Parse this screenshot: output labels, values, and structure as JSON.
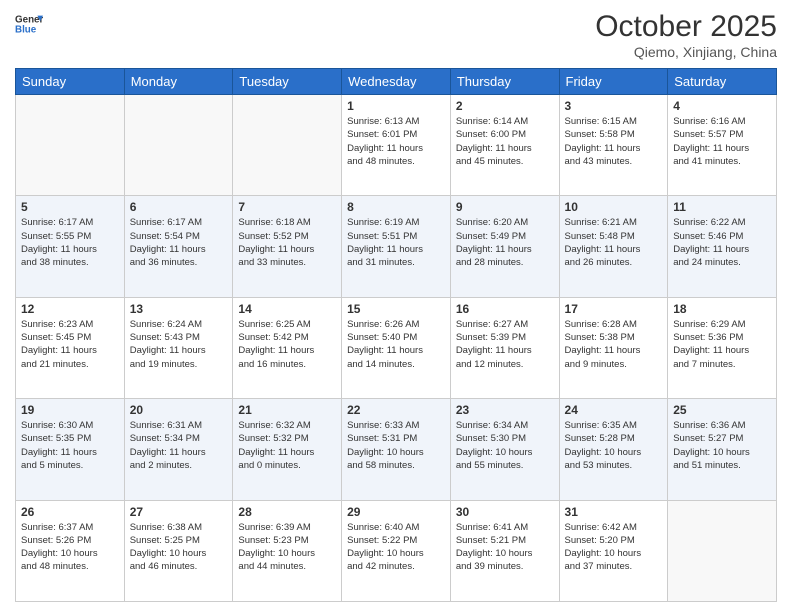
{
  "header": {
    "title": "October 2025",
    "location": "Qiemo, Xinjiang, China"
  },
  "weekdays": [
    "Sunday",
    "Monday",
    "Tuesday",
    "Wednesday",
    "Thursday",
    "Friday",
    "Saturday"
  ],
  "weeks": [
    [
      {
        "day": "",
        "info": ""
      },
      {
        "day": "",
        "info": ""
      },
      {
        "day": "",
        "info": ""
      },
      {
        "day": "1",
        "info": "Sunrise: 6:13 AM\nSunset: 6:01 PM\nDaylight: 11 hours\nand 48 minutes."
      },
      {
        "day": "2",
        "info": "Sunrise: 6:14 AM\nSunset: 6:00 PM\nDaylight: 11 hours\nand 45 minutes."
      },
      {
        "day": "3",
        "info": "Sunrise: 6:15 AM\nSunset: 5:58 PM\nDaylight: 11 hours\nand 43 minutes."
      },
      {
        "day": "4",
        "info": "Sunrise: 6:16 AM\nSunset: 5:57 PM\nDaylight: 11 hours\nand 41 minutes."
      }
    ],
    [
      {
        "day": "5",
        "info": "Sunrise: 6:17 AM\nSunset: 5:55 PM\nDaylight: 11 hours\nand 38 minutes."
      },
      {
        "day": "6",
        "info": "Sunrise: 6:17 AM\nSunset: 5:54 PM\nDaylight: 11 hours\nand 36 minutes."
      },
      {
        "day": "7",
        "info": "Sunrise: 6:18 AM\nSunset: 5:52 PM\nDaylight: 11 hours\nand 33 minutes."
      },
      {
        "day": "8",
        "info": "Sunrise: 6:19 AM\nSunset: 5:51 PM\nDaylight: 11 hours\nand 31 minutes."
      },
      {
        "day": "9",
        "info": "Sunrise: 6:20 AM\nSunset: 5:49 PM\nDaylight: 11 hours\nand 28 minutes."
      },
      {
        "day": "10",
        "info": "Sunrise: 6:21 AM\nSunset: 5:48 PM\nDaylight: 11 hours\nand 26 minutes."
      },
      {
        "day": "11",
        "info": "Sunrise: 6:22 AM\nSunset: 5:46 PM\nDaylight: 11 hours\nand 24 minutes."
      }
    ],
    [
      {
        "day": "12",
        "info": "Sunrise: 6:23 AM\nSunset: 5:45 PM\nDaylight: 11 hours\nand 21 minutes."
      },
      {
        "day": "13",
        "info": "Sunrise: 6:24 AM\nSunset: 5:43 PM\nDaylight: 11 hours\nand 19 minutes."
      },
      {
        "day": "14",
        "info": "Sunrise: 6:25 AM\nSunset: 5:42 PM\nDaylight: 11 hours\nand 16 minutes."
      },
      {
        "day": "15",
        "info": "Sunrise: 6:26 AM\nSunset: 5:40 PM\nDaylight: 11 hours\nand 14 minutes."
      },
      {
        "day": "16",
        "info": "Sunrise: 6:27 AM\nSunset: 5:39 PM\nDaylight: 11 hours\nand 12 minutes."
      },
      {
        "day": "17",
        "info": "Sunrise: 6:28 AM\nSunset: 5:38 PM\nDaylight: 11 hours\nand 9 minutes."
      },
      {
        "day": "18",
        "info": "Sunrise: 6:29 AM\nSunset: 5:36 PM\nDaylight: 11 hours\nand 7 minutes."
      }
    ],
    [
      {
        "day": "19",
        "info": "Sunrise: 6:30 AM\nSunset: 5:35 PM\nDaylight: 11 hours\nand 5 minutes."
      },
      {
        "day": "20",
        "info": "Sunrise: 6:31 AM\nSunset: 5:34 PM\nDaylight: 11 hours\nand 2 minutes."
      },
      {
        "day": "21",
        "info": "Sunrise: 6:32 AM\nSunset: 5:32 PM\nDaylight: 11 hours\nand 0 minutes."
      },
      {
        "day": "22",
        "info": "Sunrise: 6:33 AM\nSunset: 5:31 PM\nDaylight: 10 hours\nand 58 minutes."
      },
      {
        "day": "23",
        "info": "Sunrise: 6:34 AM\nSunset: 5:30 PM\nDaylight: 10 hours\nand 55 minutes."
      },
      {
        "day": "24",
        "info": "Sunrise: 6:35 AM\nSunset: 5:28 PM\nDaylight: 10 hours\nand 53 minutes."
      },
      {
        "day": "25",
        "info": "Sunrise: 6:36 AM\nSunset: 5:27 PM\nDaylight: 10 hours\nand 51 minutes."
      }
    ],
    [
      {
        "day": "26",
        "info": "Sunrise: 6:37 AM\nSunset: 5:26 PM\nDaylight: 10 hours\nand 48 minutes."
      },
      {
        "day": "27",
        "info": "Sunrise: 6:38 AM\nSunset: 5:25 PM\nDaylight: 10 hours\nand 46 minutes."
      },
      {
        "day": "28",
        "info": "Sunrise: 6:39 AM\nSunset: 5:23 PM\nDaylight: 10 hours\nand 44 minutes."
      },
      {
        "day": "29",
        "info": "Sunrise: 6:40 AM\nSunset: 5:22 PM\nDaylight: 10 hours\nand 42 minutes."
      },
      {
        "day": "30",
        "info": "Sunrise: 6:41 AM\nSunset: 5:21 PM\nDaylight: 10 hours\nand 39 minutes."
      },
      {
        "day": "31",
        "info": "Sunrise: 6:42 AM\nSunset: 5:20 PM\nDaylight: 10 hours\nand 37 minutes."
      },
      {
        "day": "",
        "info": ""
      }
    ]
  ]
}
